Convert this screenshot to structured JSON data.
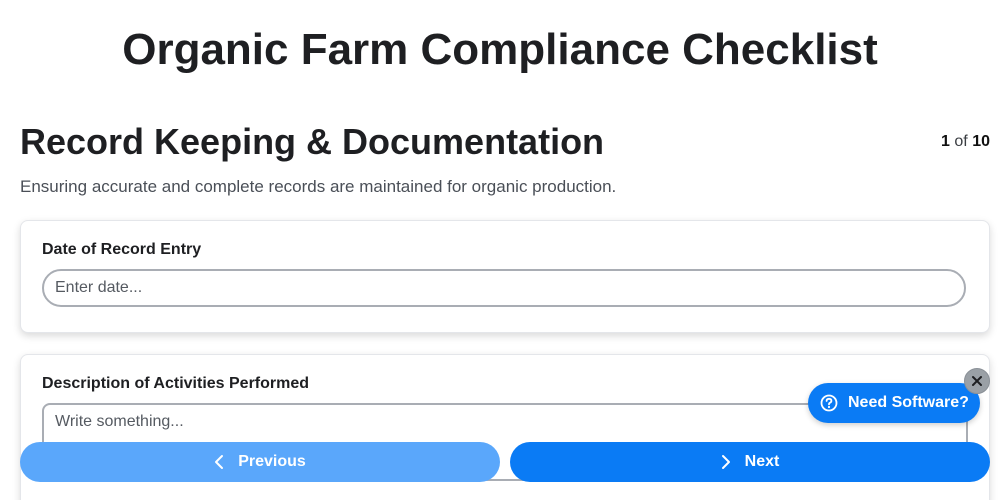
{
  "page": {
    "title": "Organic Farm Compliance Checklist"
  },
  "section": {
    "title": "Record Keeping & Documentation",
    "description": "Ensuring accurate and complete records are maintained for organic production.",
    "counter": {
      "current": "1",
      "separator": "of",
      "total": "10"
    }
  },
  "fields": {
    "date": {
      "label": "Date of Record Entry",
      "placeholder": "Enter date...",
      "value": ""
    },
    "activities": {
      "label": "Description of Activities Performed",
      "placeholder": "Write something...",
      "value": ""
    }
  },
  "navigation": {
    "previous_label": "Previous",
    "next_label": "Next"
  },
  "help_widget": {
    "label": "Need Software?",
    "icon": "question-circle-icon",
    "close_icon": "close-icon"
  },
  "colors": {
    "primary": "#0a7bf5",
    "primary_light": "#5aa7fb",
    "close_button": "#9aa0a6"
  }
}
